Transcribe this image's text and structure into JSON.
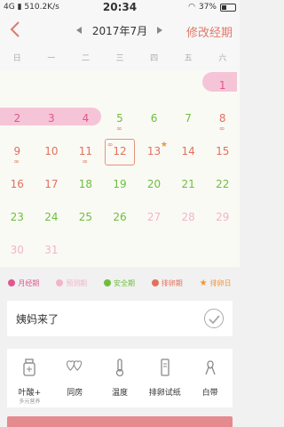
{
  "status_bar": {
    "network": "4G",
    "speed": "510.2K/s",
    "time": "20:34",
    "battery": "37%",
    "battery_level": 0.37
  },
  "header": {
    "month": "2017年7月",
    "edit_label": "修改经期"
  },
  "weekdays": [
    "日",
    "一",
    "二",
    "三",
    "四",
    "五",
    "六"
  ],
  "calendar": {
    "days": [
      {
        "n": "1",
        "type": "period"
      },
      {
        "n": "2",
        "type": "period"
      },
      {
        "n": "3",
        "type": "period"
      },
      {
        "n": "4",
        "type": "period"
      },
      {
        "n": "5",
        "type": "safe",
        "link": true
      },
      {
        "n": "6",
        "type": "safe"
      },
      {
        "n": "7",
        "type": "safe"
      },
      {
        "n": "8",
        "type": "ovulation",
        "link": true
      },
      {
        "n": "9",
        "type": "ovulation",
        "link": true
      },
      {
        "n": "10",
        "type": "ovulation"
      },
      {
        "n": "11",
        "type": "ovulation",
        "link": true
      },
      {
        "n": "12",
        "type": "ovulation",
        "link_top": true,
        "selected": true
      },
      {
        "n": "13",
        "type": "ovulation",
        "star": true
      },
      {
        "n": "14",
        "type": "ovulation"
      },
      {
        "n": "15",
        "type": "ovulation"
      },
      {
        "n": "16",
        "type": "ovulation"
      },
      {
        "n": "17",
        "type": "ovulation"
      },
      {
        "n": "18",
        "type": "safe"
      },
      {
        "n": "19",
        "type": "safe"
      },
      {
        "n": "20",
        "type": "safe"
      },
      {
        "n": "21",
        "type": "safe"
      },
      {
        "n": "22",
        "type": "safe"
      },
      {
        "n": "23",
        "type": "safe"
      },
      {
        "n": "24",
        "type": "safe"
      },
      {
        "n": "25",
        "type": "safe"
      },
      {
        "n": "26",
        "type": "safe"
      },
      {
        "n": "27",
        "type": "predicted"
      },
      {
        "n": "28",
        "type": "predicted"
      },
      {
        "n": "29",
        "type": "predicted"
      },
      {
        "n": "30",
        "type": "predicted"
      },
      {
        "n": "31",
        "type": "predicted"
      }
    ]
  },
  "colors": {
    "period": "#e0578f",
    "predicted": "#f2b4cb",
    "safe": "#6cbf3b",
    "ovulation": "#e4705c",
    "ovulation_day": "#f0953a"
  },
  "legend": [
    {
      "label": "月经期",
      "color": "#e0578f"
    },
    {
      "label": "预测期",
      "color": "#f2b4cb"
    },
    {
      "label": "安全期",
      "color": "#6cbf3b"
    },
    {
      "label": "排卵期",
      "color": "#e4705c"
    },
    {
      "label": "排卵日",
      "color": "#f0953a",
      "icon": "star-icon"
    }
  ],
  "aunt": {
    "label": "姨妈来了"
  },
  "tools": [
    {
      "label": "叶酸+",
      "sub": "多元营养",
      "icon": "bottle-icon"
    },
    {
      "label": "同房",
      "icon": "hearts-icon"
    },
    {
      "label": "温度",
      "icon": "thermometer-icon"
    },
    {
      "label": "排卵试纸",
      "icon": "test-strip-icon"
    },
    {
      "label": "白带",
      "icon": "ribbon-icon"
    }
  ]
}
